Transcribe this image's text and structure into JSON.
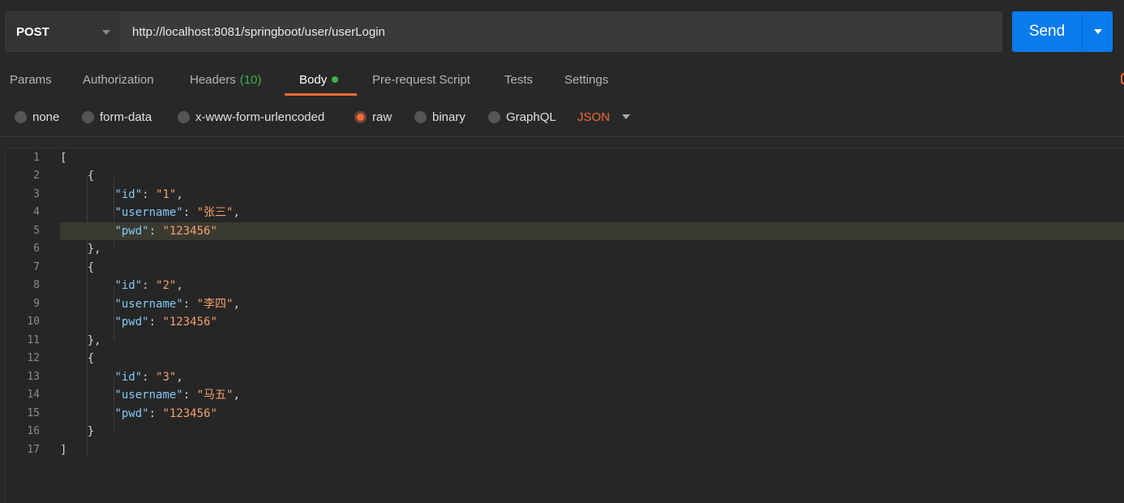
{
  "request": {
    "method": "POST",
    "url": "http://localhost:8081/springboot/user/userLogin",
    "send_label": "Send"
  },
  "tabs": [
    {
      "label": "Params"
    },
    {
      "label": "Authorization"
    },
    {
      "label": "Headers",
      "count": "(10)"
    },
    {
      "label": "Body",
      "active": true
    },
    {
      "label": "Pre-request Script"
    },
    {
      "label": "Tests"
    },
    {
      "label": "Settings"
    }
  ],
  "body_types": [
    {
      "label": "none"
    },
    {
      "label": "form-data"
    },
    {
      "label": "x-www-form-urlencoded"
    },
    {
      "label": "raw",
      "selected": true
    },
    {
      "label": "binary"
    },
    {
      "label": "GraphQL"
    }
  ],
  "format": "JSON",
  "colors": {
    "accent": "#f26b3a",
    "send": "#097bed",
    "active_dot": "#3eb34a",
    "json_key": "#82c9f5",
    "json_string": "#f2a16e"
  },
  "editor": {
    "highlighted_line": 5,
    "lines": [
      {
        "n": "1",
        "text": "["
      },
      {
        "n": "2",
        "text": "    {"
      },
      {
        "n": "3",
        "indent": "        ",
        "key": "\"id\"",
        "sep": ": ",
        "value": "\"1\"",
        "tail": ","
      },
      {
        "n": "4",
        "indent": "        ",
        "key": "\"username\"",
        "sep": ": ",
        "value": "\"张三\"",
        "tail": ","
      },
      {
        "n": "5",
        "indent": "        ",
        "key": "\"pwd\"",
        "sep": ": ",
        "value": "\"123456\"",
        "tail": ""
      },
      {
        "n": "6",
        "text": "    },"
      },
      {
        "n": "7",
        "text": "    {"
      },
      {
        "n": "8",
        "indent": "        ",
        "key": "\"id\"",
        "sep": ": ",
        "value": "\"2\"",
        "tail": ","
      },
      {
        "n": "9",
        "indent": "        ",
        "key": "\"username\"",
        "sep": ": ",
        "value": "\"李四\"",
        "tail": ","
      },
      {
        "n": "10",
        "indent": "        ",
        "key": "\"pwd\"",
        "sep": ": ",
        "value": "\"123456\"",
        "tail": ""
      },
      {
        "n": "11",
        "text": "    },"
      },
      {
        "n": "12",
        "text": "    {"
      },
      {
        "n": "13",
        "indent": "        ",
        "key": "\"id\"",
        "sep": ": ",
        "value": "\"3\"",
        "tail": ","
      },
      {
        "n": "14",
        "indent": "        ",
        "key": "\"username\"",
        "sep": ": ",
        "value": "\"马五\"",
        "tail": ","
      },
      {
        "n": "15",
        "indent": "        ",
        "key": "\"pwd\"",
        "sep": ": ",
        "value": "\"123456\"",
        "tail": ""
      },
      {
        "n": "16",
        "text": "    }"
      },
      {
        "n": "17",
        "text": "]"
      }
    ]
  }
}
